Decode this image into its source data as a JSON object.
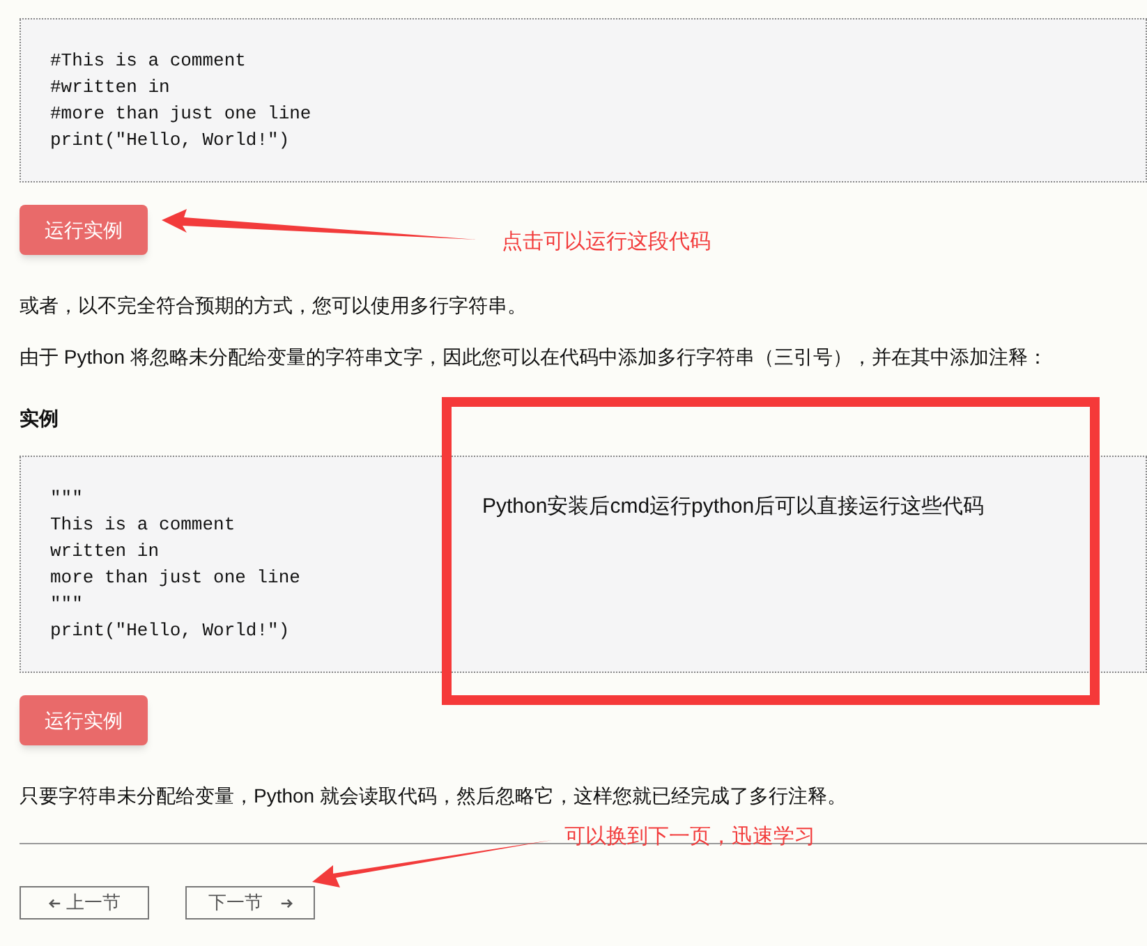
{
  "blocks": [
    {
      "kind": "code",
      "lines": [
        "#This is a comment",
        "#written in",
        "#more than just one line",
        "print(\"Hello, World!\")"
      ]
    },
    {
      "kind": "button",
      "label": "运行实例"
    },
    {
      "kind": "paragraph",
      "text": "或者，以不完全符合预期的方式，您可以使用多行字符串。"
    },
    {
      "kind": "paragraph",
      "text": "由于 Python 将忽略未分配给变量的字符串文字，因此您可以在代码中添加多行字符串（三引号），并在其中添加注释："
    },
    {
      "kind": "heading",
      "text": "实例"
    },
    {
      "kind": "code",
      "lines": [
        "\"\"\"",
        "This is a comment",
        "written in",
        "more than just one line",
        "\"\"\"",
        "print(\"Hello, World!\")"
      ]
    },
    {
      "kind": "button",
      "label": "运行实例"
    },
    {
      "kind": "paragraph",
      "text": "只要字符串未分配给变量，Python 就会读取代码，然后忽略它，这样您就已经完成了多行注释。"
    }
  ],
  "nav": [
    {
      "label": "上一节",
      "kind": "prev"
    },
    {
      "label": "下一节",
      "kind": "next"
    }
  ],
  "annotations": {
    "run_note": "点击可以运行这段代码",
    "box_note": "Python安装后cmd运行python后可以直接运行这些代码",
    "next_note": "可以换到下一页，迅速学习"
  }
}
